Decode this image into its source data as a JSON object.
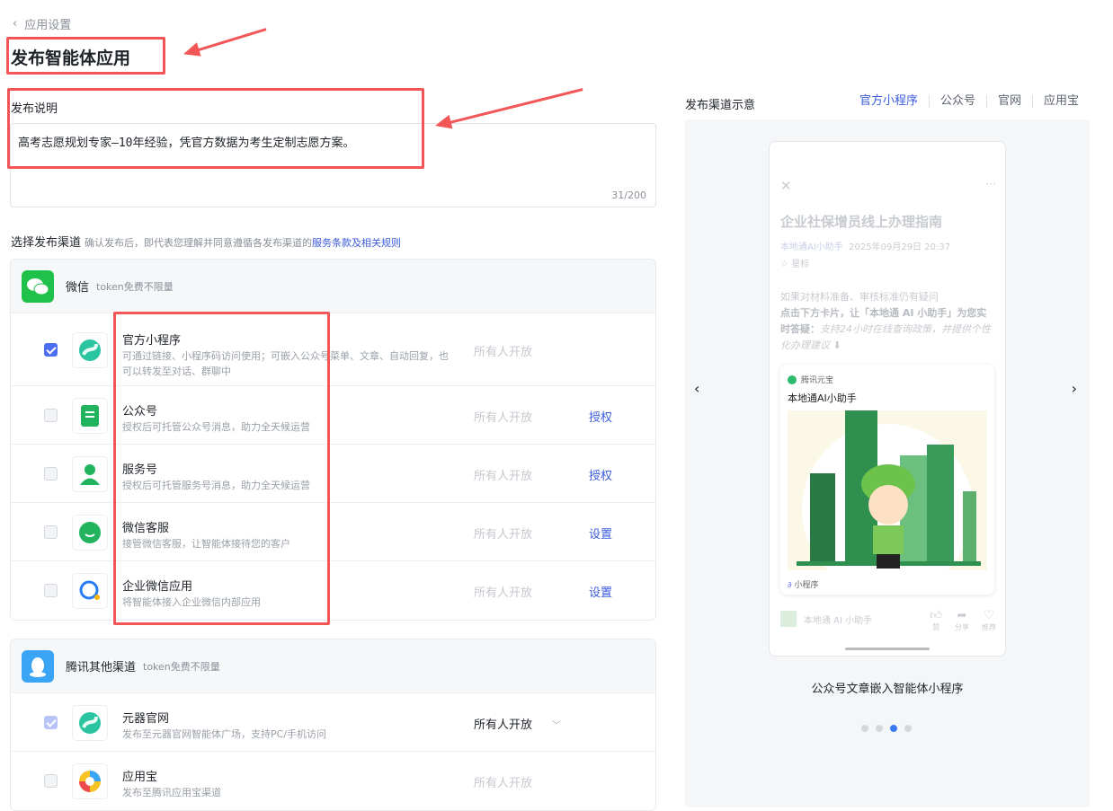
{
  "header": {
    "back_label": "应用设置",
    "title": "发布智能体应用"
  },
  "description": {
    "label": "发布说明",
    "value": "高考志愿规划专家—10年经验，凭官方数据为考生定制志愿方案。",
    "count": "31/200"
  },
  "channels": {
    "title": "选择发布渠道",
    "hint": "确认发布后，即代表您理解并同意遵循各发布渠道的",
    "link": "服务条款及相关规则"
  },
  "groups": [
    {
      "name": "微信",
      "sub": "token免费不限量",
      "icon": "wechat-icon",
      "color": "#1fc14a",
      "rows": [
        {
          "name": "官方小程序",
          "desc": "可通过链接、小程序码访问使用；可嵌入公众号菜单、文章、自动回复，也可以转发至对话、群聊中",
          "status": "所有人开放",
          "action": "",
          "checked": "on",
          "icon": "yuanqi-logo-icon"
        },
        {
          "name": "公众号",
          "desc": "授权后可托管公众号消息，助力全天候运营",
          "status": "所有人开放",
          "action": "授权",
          "checked": "off",
          "icon": "official-account-icon"
        },
        {
          "name": "服务号",
          "desc": "授权后可托管服务号消息，助力全天候运营",
          "status": "所有人开放",
          "action": "授权",
          "checked": "off",
          "icon": "service-account-icon"
        },
        {
          "name": "微信客服",
          "desc": "接管微信客服，让智能体接待您的客户",
          "status": "所有人开放",
          "action": "设置",
          "checked": "off",
          "icon": "wechat-service-icon"
        },
        {
          "name": "企业微信应用",
          "desc": "将智能体接入企业微信内部应用",
          "status": "所有人开放",
          "action": "设置",
          "checked": "off",
          "icon": "wecom-icon"
        }
      ]
    },
    {
      "name": "腾讯其他渠道",
      "sub": "token免费不限量",
      "icon": "qq-icon",
      "color": "#3aa5f5",
      "rows": [
        {
          "name": "元器官网",
          "desc": "发布至元器官网智能体广场，支持PC/手机访问",
          "status": "所有人开放",
          "action": "",
          "checked": "dis",
          "icon": "yuanqi-logo-icon",
          "dropdown": true
        },
        {
          "name": "应用宝",
          "desc": "发布至腾讯应用宝渠道",
          "status": "所有人开放",
          "action": "",
          "checked": "off",
          "icon": "app-store-icon"
        }
      ]
    }
  ],
  "preview": {
    "title": "发布渠道示意",
    "tabs": [
      "官方小程序",
      "公众号",
      "官网",
      "应用宝"
    ],
    "article_title": "企业社保增员线上办理指南",
    "author": "本地通AI小助手",
    "date": "2025年09月29日 20:37",
    "star": "☆ 星标",
    "para1": "如果对材料准备、审核标准仍有疑问",
    "para2": "点击下方卡片，让「本地通 AI 小助手」为您实时答疑：",
    "para3": "支持24小时在线查询政策，并提供个性化办理建议 ⬇",
    "card_brand": "腾讯元宝",
    "card_title": "本地通AI小助手",
    "card_tag": "小程序",
    "footer_name": "本地通 AI 小助手",
    "actions": [
      "赞",
      "分享",
      "推荐"
    ],
    "caption": "公众号文章嵌入智能体小程序",
    "active_dot": 2,
    "dot_count": 4
  }
}
